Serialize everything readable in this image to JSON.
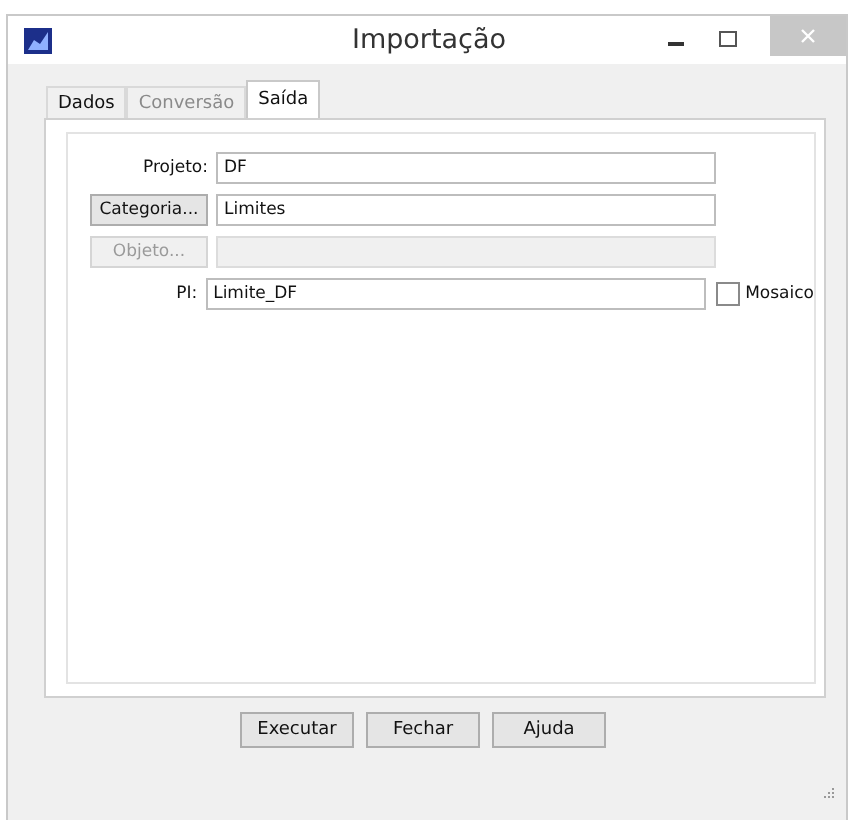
{
  "window": {
    "title": "Importação"
  },
  "tabs": [
    {
      "label": "Dados",
      "selected": false,
      "disabled": false
    },
    {
      "label": "Conversão",
      "selected": false,
      "disabled": true
    },
    {
      "label": "Saída",
      "selected": true,
      "disabled": false
    }
  ],
  "fields": [
    {
      "kind": "label",
      "label": "Projeto:",
      "value": "DF",
      "disabled": false
    },
    {
      "kind": "button",
      "label": "Categoria...",
      "value": "Limites",
      "disabled": false
    },
    {
      "kind": "button",
      "label": "Objeto...",
      "disabled": true
    },
    {
      "kind": "label",
      "label": "PI:",
      "value": "Limite_DF",
      "disabled": false,
      "checkbox": {
        "label": "Mosaico",
        "checked": false
      }
    }
  ],
  "buttons": [
    "Executar",
    "Fechar",
    "Ajuda"
  ]
}
